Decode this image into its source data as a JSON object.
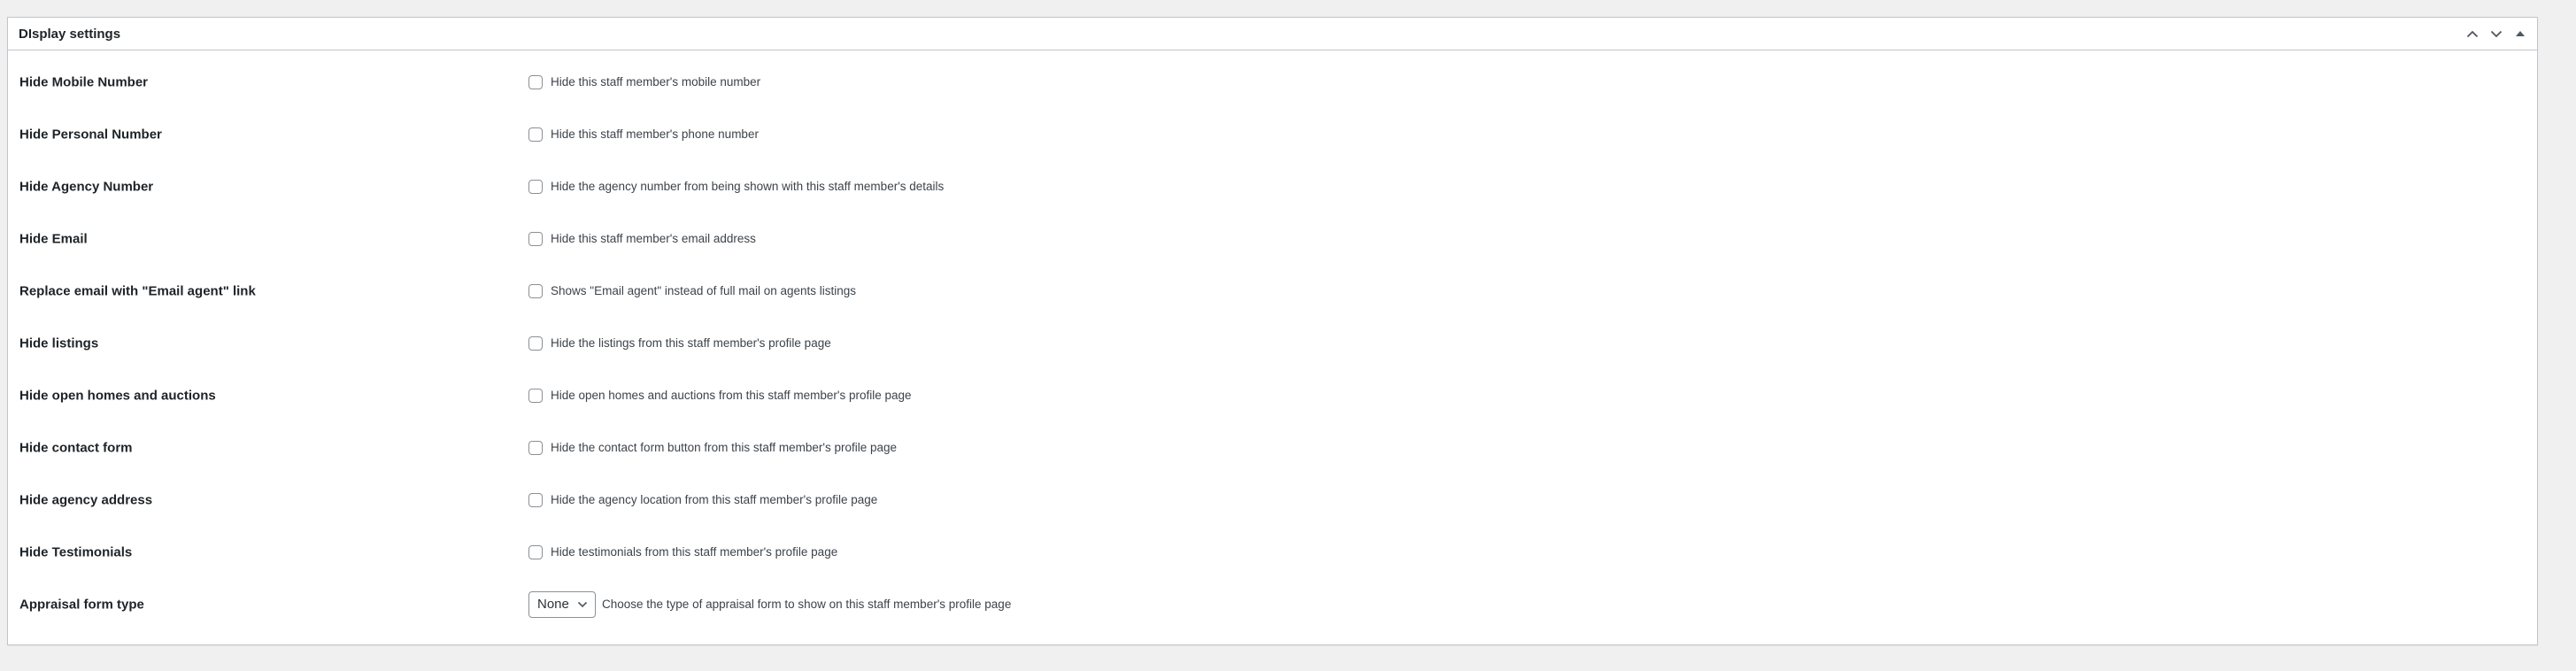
{
  "postbox": {
    "title": "DIsplay settings",
    "actions": [
      "move-up",
      "move-down",
      "toggle-panel"
    ]
  },
  "rows": [
    {
      "label": "Hide Mobile Number",
      "description": "Hide this staff member's mobile number"
    },
    {
      "label": "Hide Personal Number",
      "description": "Hide this staff member's phone number"
    },
    {
      "label": "Hide Agency Number",
      "description": "Hide the agency number from being shown with this staff member's details"
    },
    {
      "label": "Hide Email",
      "description": "Hide this staff member's email address"
    },
    {
      "label": "Replace email with \"Email agent\" link",
      "description": "Shows \"Email agent\" instead of full mail on agents listings"
    },
    {
      "label": "Hide listings",
      "description": "Hide the listings from this staff member's profile page"
    },
    {
      "label": "Hide open homes and auctions",
      "description": "Hide open homes and auctions from this staff member's profile page"
    },
    {
      "label": "Hide contact form",
      "description": "Hide the contact form button from this staff member's profile page"
    },
    {
      "label": "Hide agency address",
      "description": "Hide the agency location from this staff member's profile page"
    },
    {
      "label": "Hide Testimonials",
      "description": "Hide testimonials from this staff member's profile page"
    }
  ],
  "appraisal": {
    "label": "Appraisal form type",
    "selected": "None",
    "description": "Choose the type of appraisal form to show on this staff member's profile page"
  }
}
